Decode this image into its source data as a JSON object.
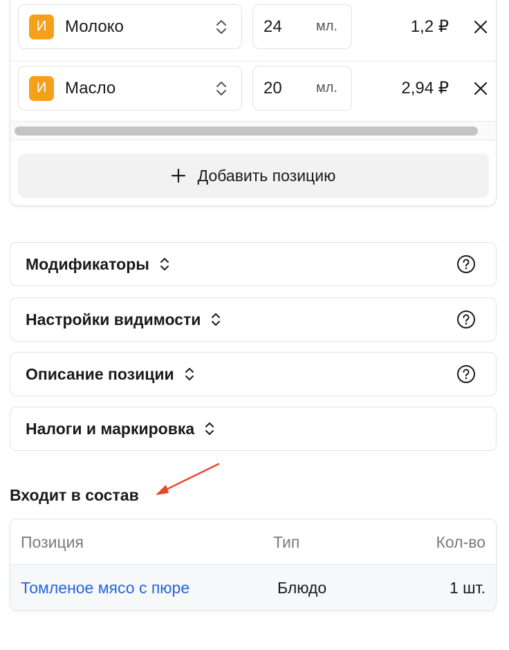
{
  "ingredients": {
    "rows": [
      {
        "badge": "И",
        "name": "Молоко",
        "qty": "24",
        "unit": "мл.",
        "price": "1,2 ₽"
      },
      {
        "badge": "И",
        "name": "Масло",
        "qty": "20",
        "unit": "мл.",
        "price": "2,94 ₽"
      }
    ],
    "add_label": "Добавить позицию"
  },
  "sections": [
    {
      "title": "Модификаторы",
      "has_help": true
    },
    {
      "title": "Настройки видимости",
      "has_help": true
    },
    {
      "title": "Описание позиции",
      "has_help": true
    },
    {
      "title": "Налоги и маркировка",
      "has_help": false
    }
  ],
  "part_of": {
    "title": "Входит в состав",
    "columns": {
      "position": "Позиция",
      "type": "Тип",
      "qty": "Кол-во"
    },
    "rows": [
      {
        "position": "Томленое мясо с пюре",
        "type": "Блюдо",
        "qty": "1 шт."
      }
    ]
  },
  "colors": {
    "badge": "#f5a01a",
    "link": "#2266e0",
    "arrow": "#e8452c"
  }
}
